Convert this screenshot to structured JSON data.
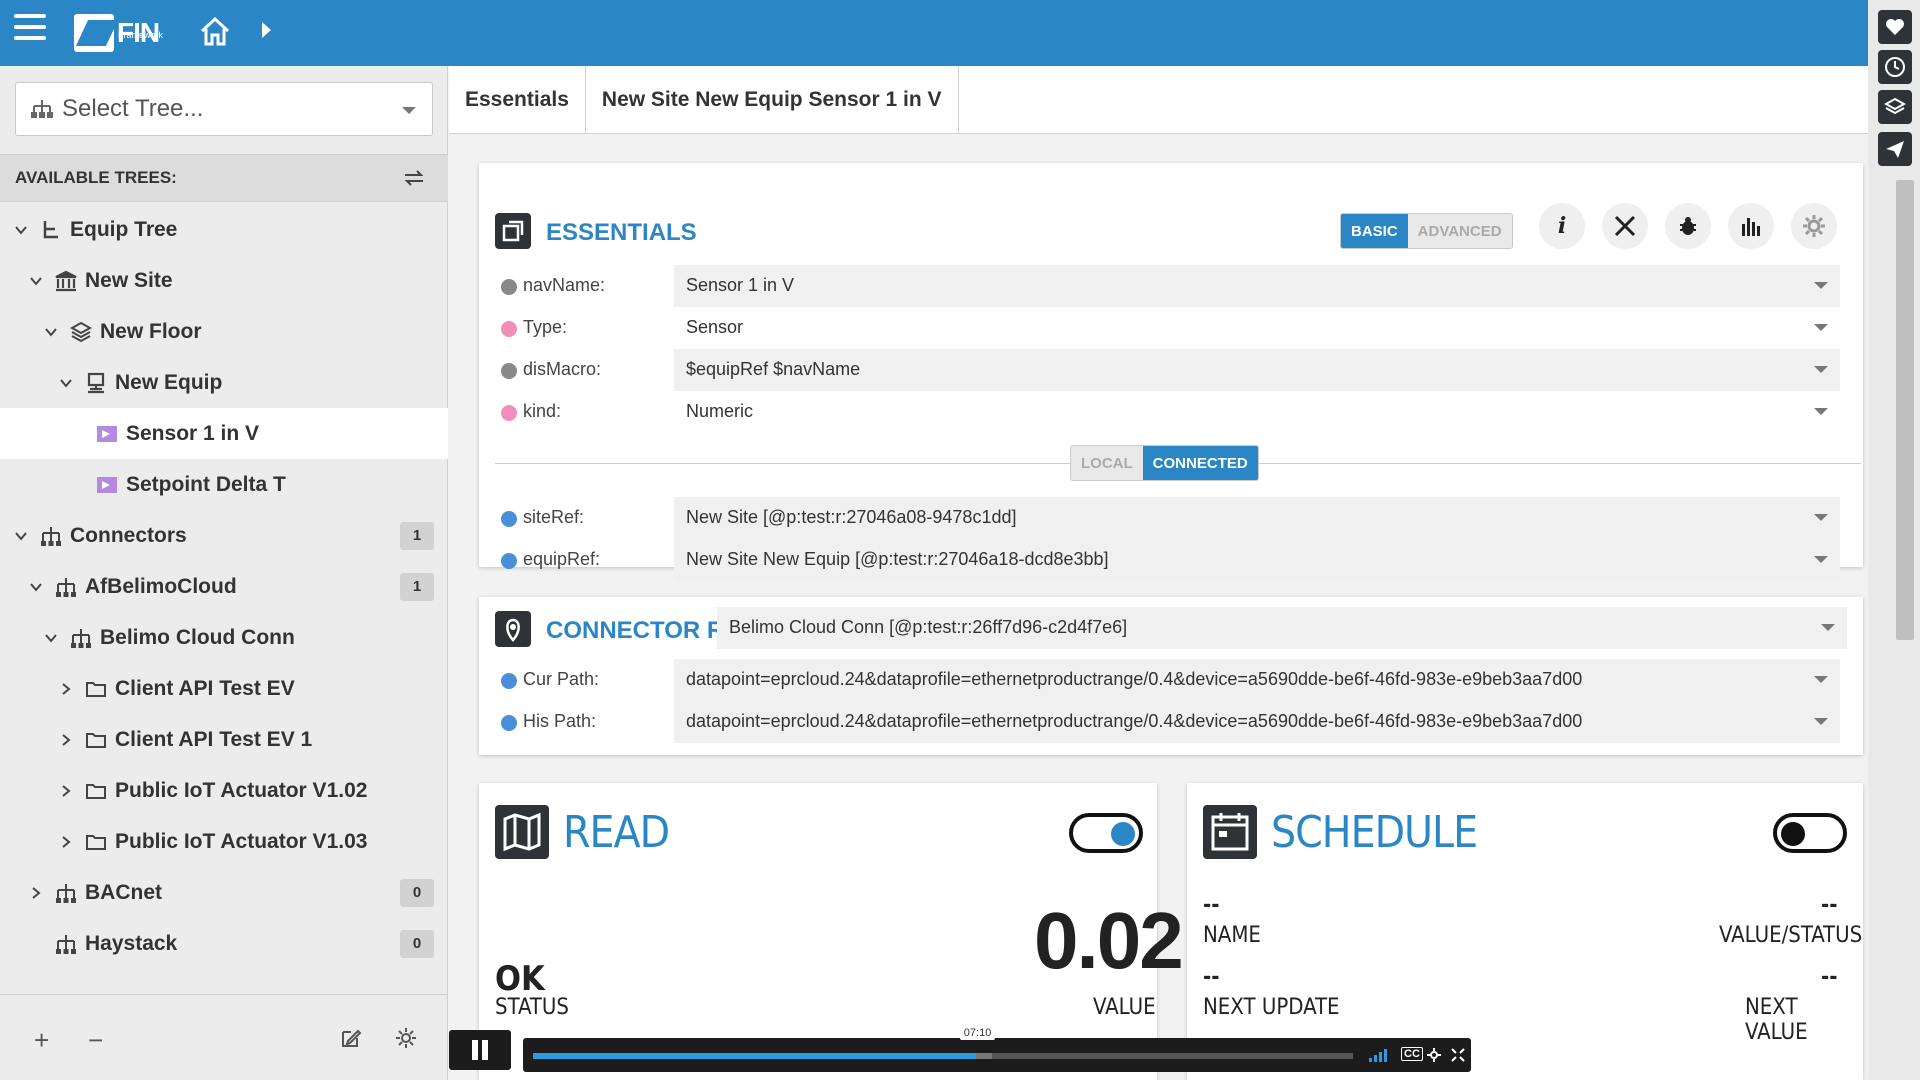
{
  "app": {
    "logo_text": "FIN",
    "logo_sub": "Framework"
  },
  "sidebar": {
    "select_tree_placeholder": "Select Tree...",
    "available_trees_label": "AVAILABLE TREES:",
    "tree": [
      {
        "label": "Equip Tree",
        "level": 0,
        "expanded": true,
        "icon": "equip-tree-icon"
      },
      {
        "label": "New Site",
        "level": 1,
        "expanded": true,
        "icon": "site-icon"
      },
      {
        "label": "New Floor",
        "level": 2,
        "expanded": true,
        "icon": "floor-icon"
      },
      {
        "label": "New Equip",
        "level": 3,
        "expanded": true,
        "icon": "equip-icon"
      },
      {
        "label": "Sensor 1 in V",
        "level": 4,
        "selected": true,
        "icon": "point-icon"
      },
      {
        "label": "Setpoint Delta T",
        "level": 4,
        "icon": "point-icon"
      },
      {
        "label": "Connectors",
        "level": 0,
        "expanded": true,
        "badge": "1",
        "icon": "connector-icon"
      },
      {
        "label": "AfBelimoCloud",
        "level": 1,
        "expanded": true,
        "badge": "1",
        "icon": "connector-icon"
      },
      {
        "label": "Belimo Cloud Conn",
        "level": 2,
        "expanded": true,
        "icon": "connector-icon"
      },
      {
        "label": "Client API Test EV",
        "level": 3,
        "expanded": false,
        "icon": "folder-icon"
      },
      {
        "label": "Client API Test EV 1",
        "level": 3,
        "expanded": false,
        "icon": "folder-icon"
      },
      {
        "label": "Public IoT Actuator V1.02",
        "level": 3,
        "expanded": false,
        "icon": "folder-icon"
      },
      {
        "label": "Public IoT Actuator V1.03",
        "level": 3,
        "expanded": false,
        "icon": "folder-icon"
      },
      {
        "label": "BACnet",
        "level": 1,
        "expanded": false,
        "badge": "0",
        "icon": "connector-icon"
      },
      {
        "label": "Haystack",
        "level": 1,
        "badge": "0",
        "icon": "connector-icon"
      }
    ],
    "bottom": {
      "add": "+",
      "remove": "−"
    }
  },
  "tabs": [
    {
      "label": "Essentials",
      "active": true
    },
    {
      "label": "New Site New Equip Sensor 1 in V",
      "active": false
    }
  ],
  "essentials": {
    "title": "ESSENTIALS",
    "mode_basic": "BASIC",
    "mode_advanced": "ADVANCED",
    "fields": [
      {
        "label": "navName:",
        "value": "Sensor 1 in V",
        "dot": "#888888"
      },
      {
        "label": "Type:",
        "value": "Sensor",
        "dot": "#f08fb8"
      },
      {
        "label": "disMacro:",
        "value": "$equipRef $navName",
        "dot": "#888888"
      },
      {
        "label": "kind:",
        "value": "Numeric",
        "dot": "#f08fb8"
      }
    ],
    "toggle_local": "LOCAL",
    "toggle_connected": "CONNECTED",
    "ref_fields": [
      {
        "label": "siteRef:",
        "value": "New Site [@p:test:r:27046a08-9478c1dd]",
        "dot": "#4a8fd9"
      },
      {
        "label": "equipRef:",
        "value": "New Site New Equip [@p:test:r:27046a18-dcd8e3bb]",
        "dot": "#4a8fd9"
      }
    ]
  },
  "connector_ref": {
    "title": "CONNECTOR REF",
    "value": "Belimo Cloud Conn [@p:test:r:26ff7d96-c2d4f7e6]",
    "fields": [
      {
        "label": "Cur Path:",
        "value": "datapoint=eprcloud.24&dataprofile=ethernetproductrange/0.4&device=a5690dde-be6f-46fd-983e-e9beb3aa7d00",
        "dot": "#4a8fd9"
      },
      {
        "label": "His Path:",
        "value": "datapoint=eprcloud.24&dataprofile=ethernetproductrange/0.4&device=a5690dde-be6f-46fd-983e-e9beb3aa7d00",
        "dot": "#4a8fd9"
      }
    ]
  },
  "read": {
    "title": "READ",
    "enabled": true,
    "value": "0.02",
    "status": "OK",
    "status_label": "STATUS",
    "value_label": "VALUE"
  },
  "schedule": {
    "title": "SCHEDULE",
    "enabled": false,
    "name": "--",
    "name_label": "NAME",
    "value_status": "--",
    "value_status_label": "VALUE/STATUS",
    "next_update": "--",
    "next_update_label": "NEXT UPDATE",
    "next_value": "--",
    "next_value_label": "NEXT VALUE"
  },
  "video": {
    "time_tooltip": "07:10",
    "progress_fraction": 0.54,
    "buffered_fraction": 0.56
  },
  "colors": {
    "accent": "#2b86c5",
    "dark": "#2f3337"
  }
}
